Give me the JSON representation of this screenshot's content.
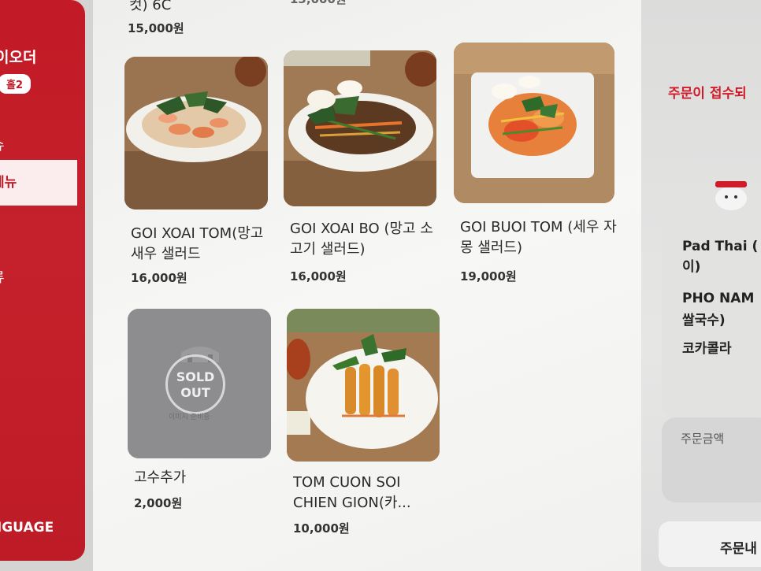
{
  "sidebar": {
    "brand": "이오더",
    "store": "홀2",
    "items": [
      {
        "label": "슈"
      },
      {
        "label": "메뉴"
      },
      {
        "label": "류"
      }
    ],
    "language": "NGUAGE"
  },
  "menu": {
    "top_partial": {
      "name_tail": "컷) 6C",
      "price": "15,000원",
      "price2": "13,000원"
    },
    "items": [
      {
        "name": "GOI XOAI TOM(망고새우 샐러드",
        "price": "16,000원",
        "sold_out": false
      },
      {
        "name": "GOI XOAI BO (망고 소고기 샐러드)",
        "price": "16,000원",
        "sold_out": false
      },
      {
        "name": "GOI BUOI TOM (세우 자몽 샐러드)",
        "price": "19,000원",
        "sold_out": false
      },
      {
        "name": "고수추가",
        "price": "2,000원",
        "sold_out": true,
        "sold_label": "SOLD OUT",
        "sold_sub": "이미지 준비중"
      },
      {
        "name": "TOM CUON SOI CHIEN GION(카...",
        "price": "10,000원",
        "sold_out": false
      }
    ]
  },
  "order_panel": {
    "notice": "주문이 접수되",
    "items": [
      "Pad Thai (",
      "이)",
      "PHO NAM",
      "쌀국수)",
      "코카콜라"
    ],
    "total_label": "주문금액",
    "order_button": "주문내"
  },
  "colors": {
    "brand_red": "#c21a26",
    "notice_red": "#d01c2a"
  }
}
